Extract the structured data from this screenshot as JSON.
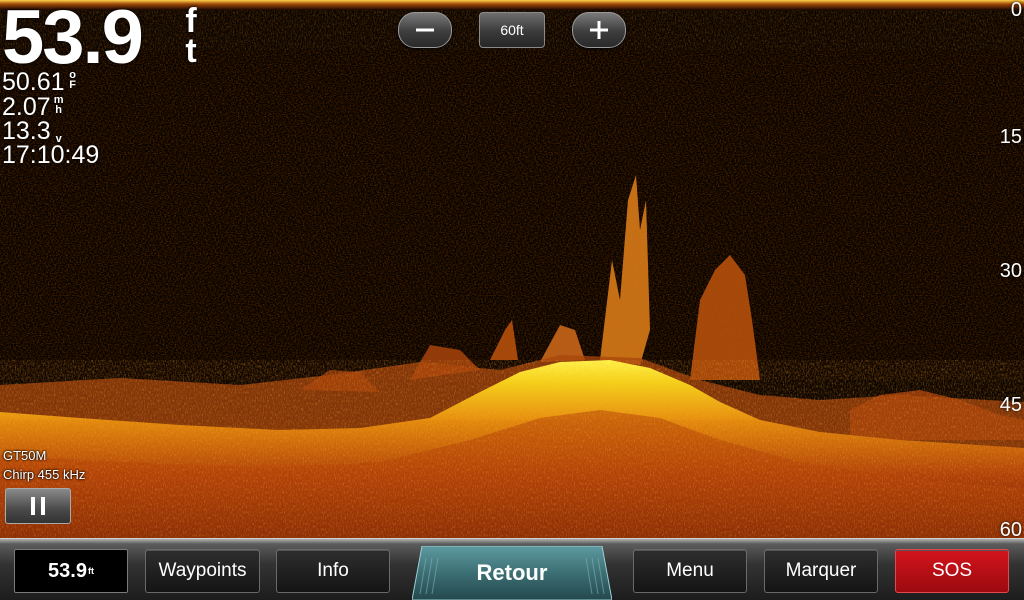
{
  "depth": {
    "value": "53.9",
    "unit_top": "f",
    "unit_bottom": "t"
  },
  "stats": [
    {
      "value": "50.61",
      "unit_top": "o",
      "unit_bottom": "F"
    },
    {
      "value": "2.07",
      "unit_top": "m",
      "unit_bottom": "h"
    },
    {
      "value": "13.3",
      "unit_single": "v"
    },
    {
      "value": "17:10:49"
    }
  ],
  "zoom": {
    "minus_icon": "minus-icon",
    "level": "60ft",
    "plus_icon": "plus-icon"
  },
  "scale": [
    "0",
    "15",
    "30",
    "45",
    "60"
  ],
  "source": {
    "transducer": "GT50M",
    "frequency": "Chirp 455 kHz"
  },
  "bottom_bar": {
    "depth_mini": "53.9",
    "depth_mini_unit": "ft",
    "waypoints": "Waypoints",
    "info": "Info",
    "retour": "Retour",
    "menu": "Menu",
    "marquer": "Marquer",
    "sos": "SOS"
  },
  "colors": {
    "sonar_bg": "#050201",
    "bottom_yellow": "#f5e31a",
    "bottom_orange": "#d86a0a",
    "bottom_red": "#7a1a06",
    "sos_red": "#c8101a",
    "retour_teal": "#3c6f74"
  }
}
